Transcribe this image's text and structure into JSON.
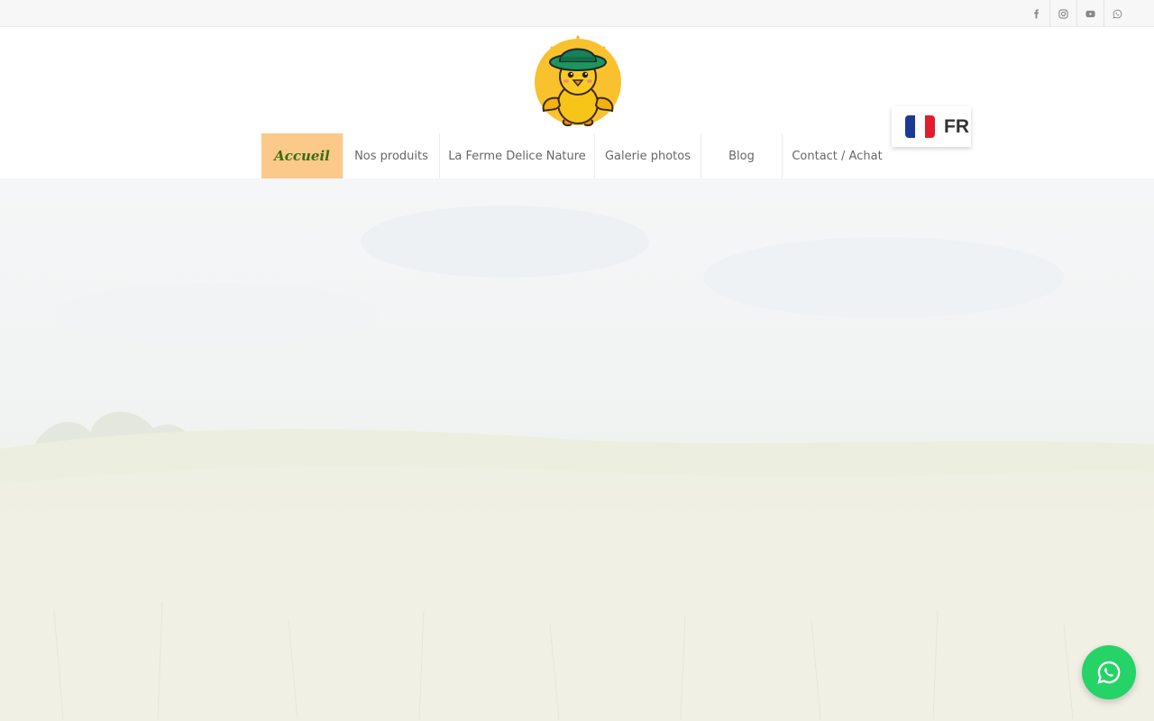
{
  "social": [
    {
      "name": "facebook-icon"
    },
    {
      "name": "instagram-icon"
    },
    {
      "name": "youtube-icon"
    },
    {
      "name": "whatsapp-icon"
    }
  ],
  "logo": {
    "icon": "chick-with-hat-logo"
  },
  "nav": {
    "items": [
      {
        "label": "Accueil",
        "active": true
      },
      {
        "label": "Nos produits"
      },
      {
        "label": "La Ferme Delice Nature"
      },
      {
        "label": "Galerie photos"
      },
      {
        "label": "Blog"
      },
      {
        "label": "Contact / Achat"
      }
    ]
  },
  "language": {
    "code": "FR",
    "flag": "france-flag-icon"
  },
  "whatsapp_button": {
    "icon": "whatsapp-icon"
  },
  "colors": {
    "active_nav_bg": "#fbc98a",
    "active_nav_text": "#3a6e12",
    "whatsapp": "#25d366"
  }
}
